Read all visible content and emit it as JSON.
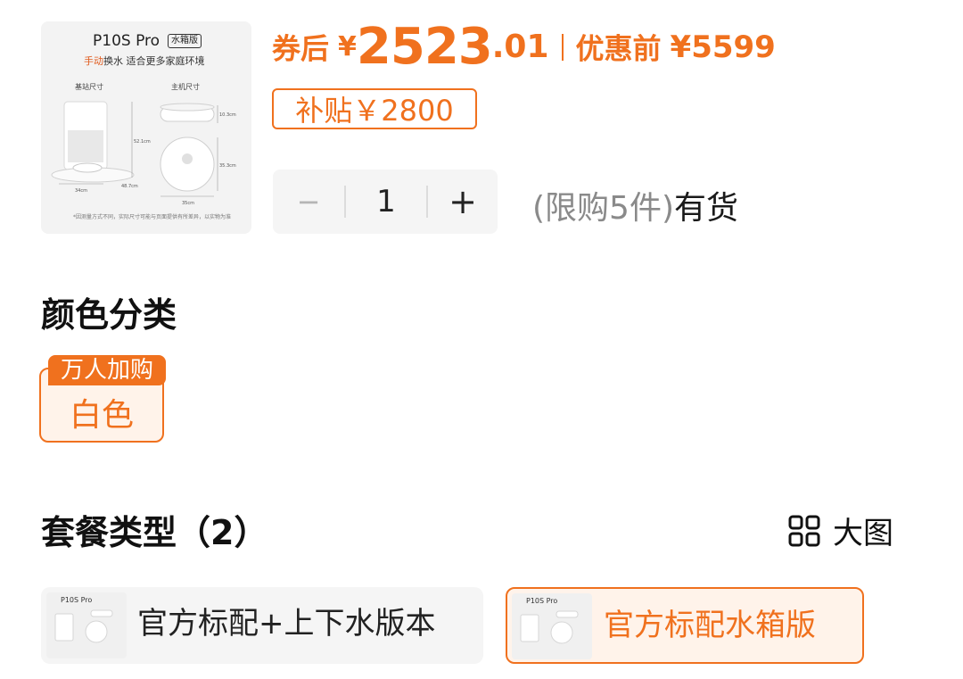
{
  "product": {
    "model": "P10S Pro",
    "edition": "水箱版",
    "tagline_highlight": "手动",
    "tagline_rest": "换水 适合更多家庭环境",
    "label_station": "基站尺寸",
    "label_robot": "主机尺寸",
    "dim_robot_height": "10.3cm",
    "dim_station_height": "52.1cm",
    "dim_robot_diameter_side": "35.3cm",
    "dim_station_width": "34cm",
    "dim_station_depth": "48.7cm",
    "dim_robot_diameter": "35cm",
    "note": "*因测量方式不同，实际尺寸可能与页面提供有所差异，以实物为准"
  },
  "price": {
    "coupon_label": "券后",
    "currency": "¥",
    "coupon_int": "2523",
    "coupon_dec": ".01",
    "orig_label": "优惠前",
    "orig_value": "¥5599",
    "subsidy": "补贴￥2800"
  },
  "quantity": {
    "minus": "−",
    "value": "1",
    "plus": "+",
    "limit": "(限购5件)",
    "stock": "有货"
  },
  "color_section": {
    "title": "颜色分类",
    "options": [
      {
        "badge": "万人加购",
        "name": "白色",
        "selected": true
      }
    ]
  },
  "package_section": {
    "title": "套餐类型（2）",
    "view_label": "大图",
    "view_icon": "grid-view-icon",
    "options": [
      {
        "label": "官方标配+上下水版本",
        "thumb_model": "P10S Pro",
        "selected": false
      },
      {
        "label": "官方标配水箱版",
        "thumb_model": "P10S Pro",
        "selected": true
      }
    ]
  },
  "colors": {
    "accent": "#f0711e",
    "accent_bg": "#fff3ea",
    "muted": "#8a8a8a"
  }
}
